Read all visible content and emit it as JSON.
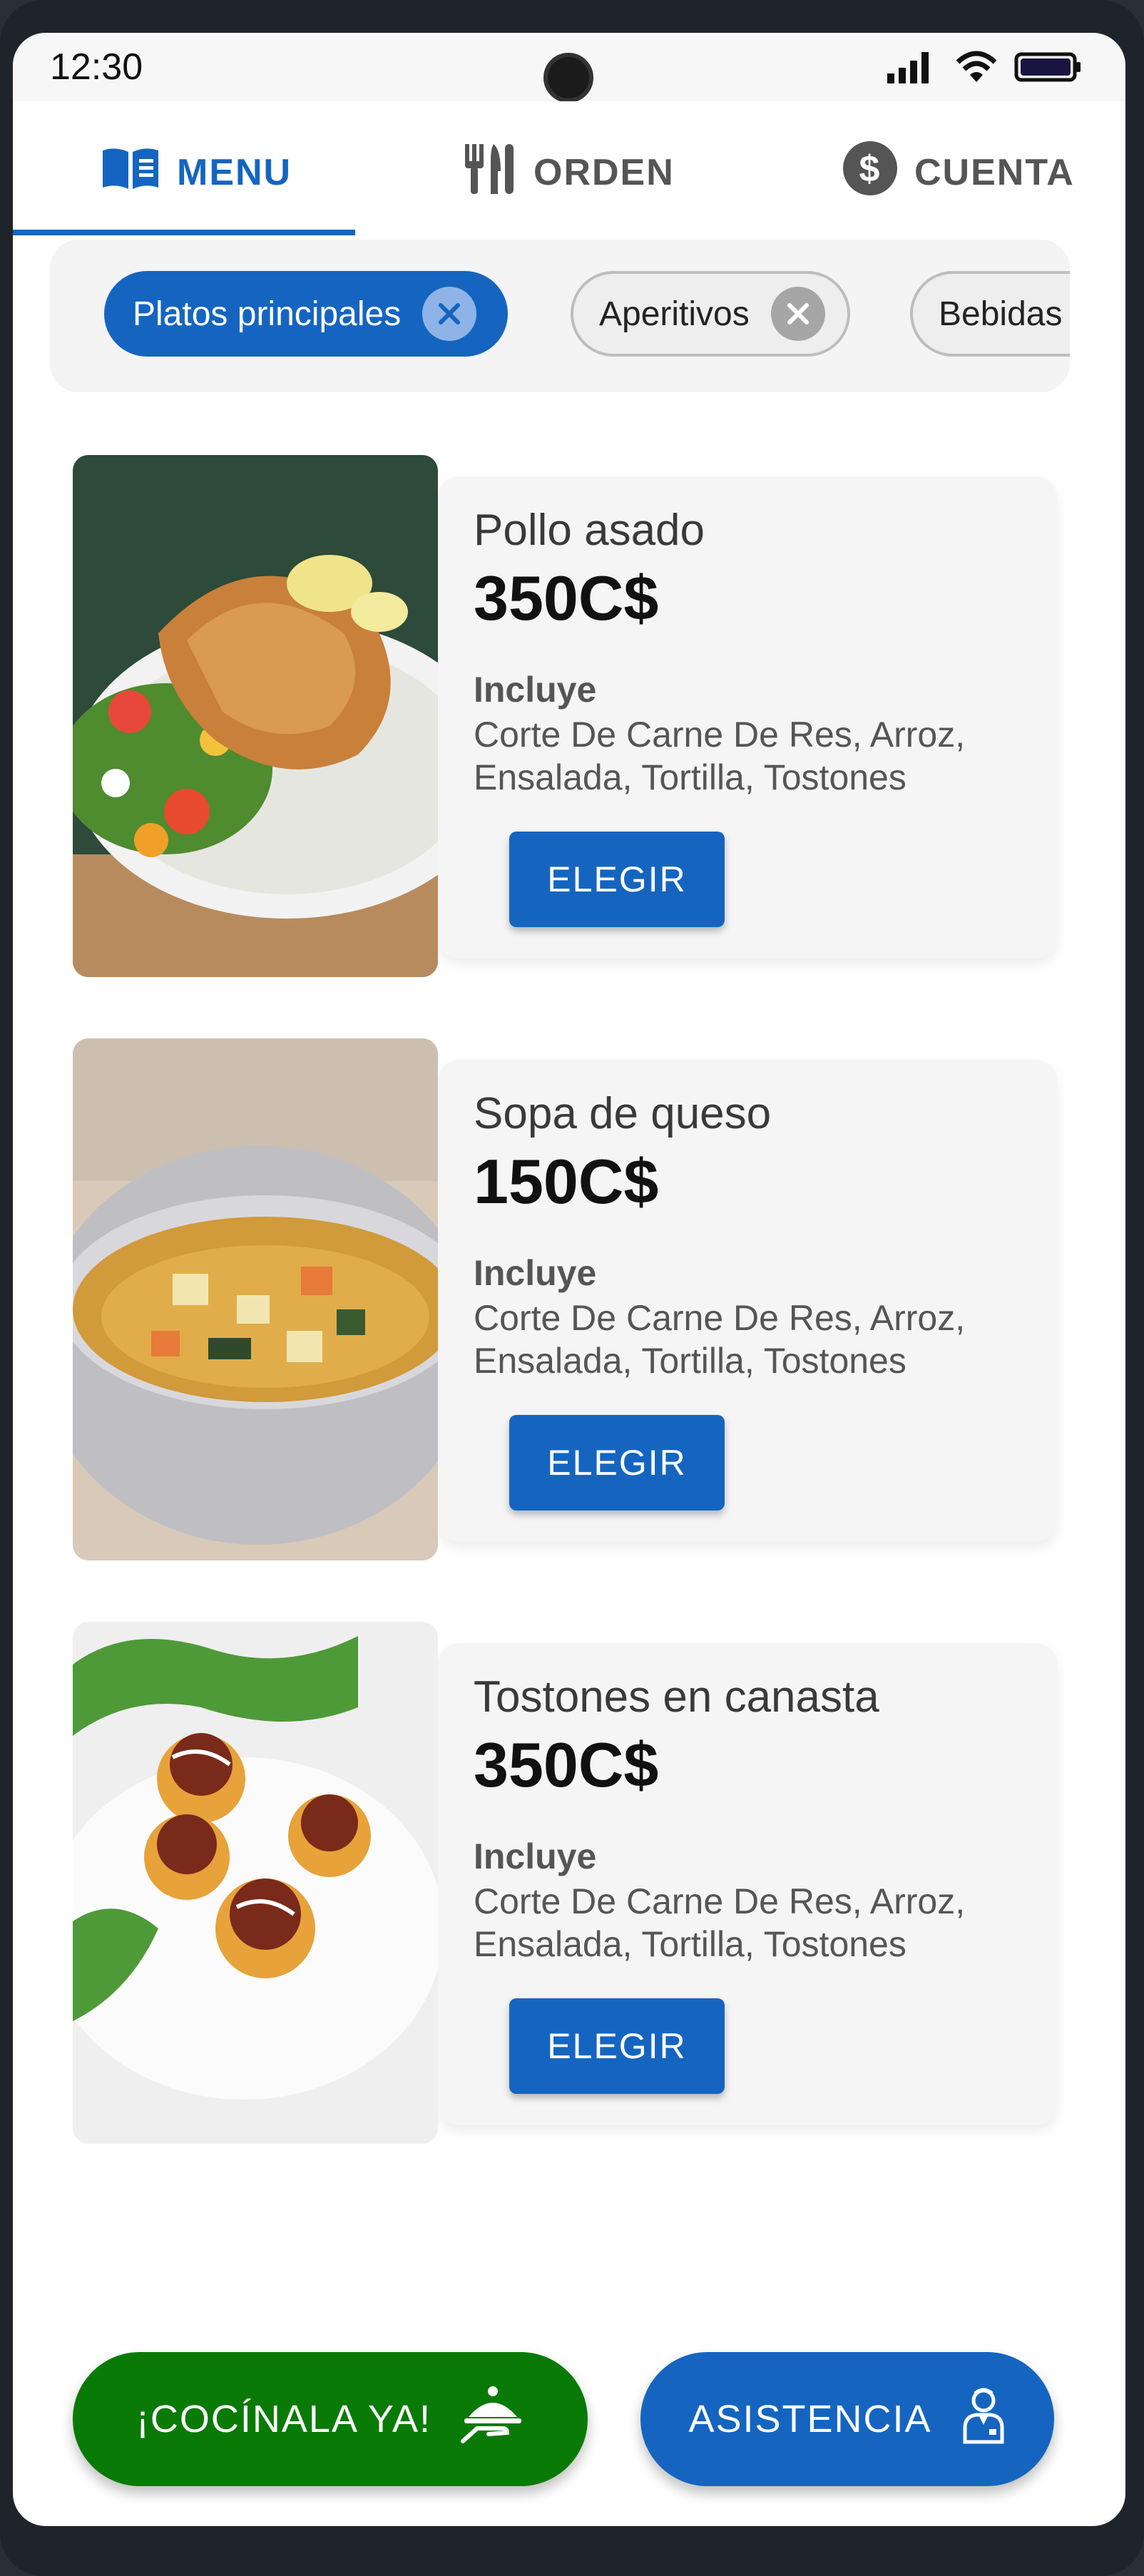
{
  "status_bar": {
    "time": "12:30"
  },
  "tabs": [
    {
      "label": "MENU",
      "icon": "menu-book-icon",
      "active": true
    },
    {
      "label": "ORDEN",
      "icon": "utensils-icon",
      "active": false
    },
    {
      "label": "CUENTA",
      "icon": "dollar-icon",
      "active": false
    }
  ],
  "filters": [
    {
      "label": "Platos principales",
      "selected": true
    },
    {
      "label": "Aperitivos",
      "selected": false
    },
    {
      "label": "Bebidas",
      "selected": false
    }
  ],
  "dishes": [
    {
      "name": "Pollo asado",
      "price": "350C$",
      "includes_label": "Incluye",
      "includes": "Corte De Carne De Res, Arroz, Ensalada, Tortilla, Tostones",
      "button": "ELEGIR"
    },
    {
      "name": "Sopa de queso",
      "price": "150C$",
      "includes_label": "Incluye",
      "includes": "Corte De Carne De Res, Arroz, Ensalada, Tortilla, Tostones",
      "button": "ELEGIR"
    },
    {
      "name": "Tostones en canasta",
      "price": "350C$",
      "includes_label": "Incluye",
      "includes": "Corte De Carne De Res, Arroz, Ensalada, Tortilla, Tostones",
      "button": "ELEGIR"
    }
  ],
  "actions": {
    "cook": {
      "label": "¡COCÍNALA YA!",
      "icon": "serving-dish-icon"
    },
    "help": {
      "label": "ASISTENCIA",
      "icon": "waiter-icon"
    }
  },
  "colors": {
    "primary": "#1565c0",
    "success": "#0a7a07"
  }
}
